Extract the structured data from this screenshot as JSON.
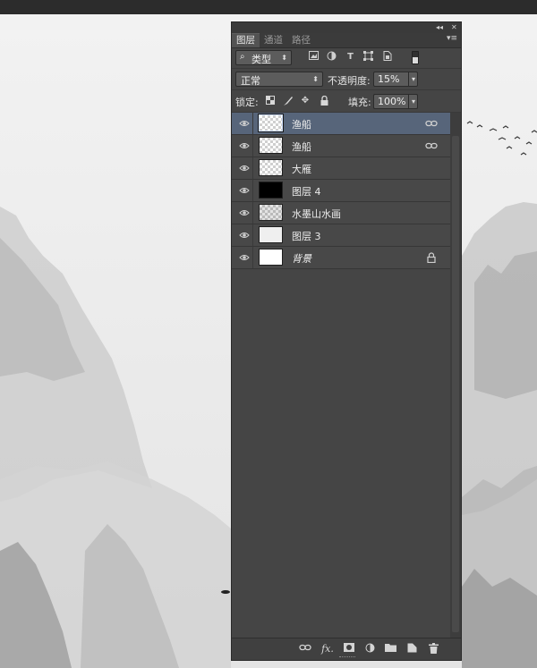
{
  "tabs": [
    {
      "label": "图层",
      "active": true
    },
    {
      "label": "通道",
      "active": false
    },
    {
      "label": "路径",
      "active": false
    }
  ],
  "filter": {
    "kind_label": "类型",
    "search_glyph": "⌕",
    "type_icons": [
      "image-filter-icon",
      "adjustment-filter-icon",
      "text-filter-icon",
      "shape-filter-icon",
      "smart-object-filter-icon"
    ]
  },
  "blend": {
    "mode": "正常",
    "opacity_label": "不透明度:",
    "opacity_value": "15%"
  },
  "lock": {
    "label": "锁定:",
    "fill_label": "填充:",
    "fill_value": "100%"
  },
  "layers": [
    {
      "name": "渔船",
      "thumb": "checker",
      "selected": true,
      "linked": true,
      "locked": false
    },
    {
      "name": "渔船",
      "thumb": "checker",
      "selected": false,
      "linked": true,
      "locked": false
    },
    {
      "name": "大雁",
      "thumb": "checker",
      "selected": false,
      "linked": false,
      "locked": false
    },
    {
      "name": "图层 4",
      "thumb": "black",
      "selected": false,
      "linked": false,
      "locked": false
    },
    {
      "name": "水墨山水画",
      "thumb": "checker",
      "selected": false,
      "linked": false,
      "locked": false
    },
    {
      "name": "图层 3",
      "thumb": "light",
      "selected": false,
      "linked": false,
      "locked": false
    },
    {
      "name": "背景",
      "thumb": "white",
      "selected": false,
      "linked": false,
      "locked": true,
      "italic": true
    }
  ],
  "bottom_icons": [
    "link-layers-icon",
    "fx-icon",
    "layer-mask-icon",
    "adjustment-layer-icon",
    "new-group-icon",
    "new-layer-icon",
    "delete-layer-icon"
  ],
  "bottom_glyphs": {
    "fx": "fx."
  },
  "colors": {
    "panel_bg": "#454545",
    "selected_row": "#57657a",
    "canvas_bg": "#f0f0f0"
  }
}
